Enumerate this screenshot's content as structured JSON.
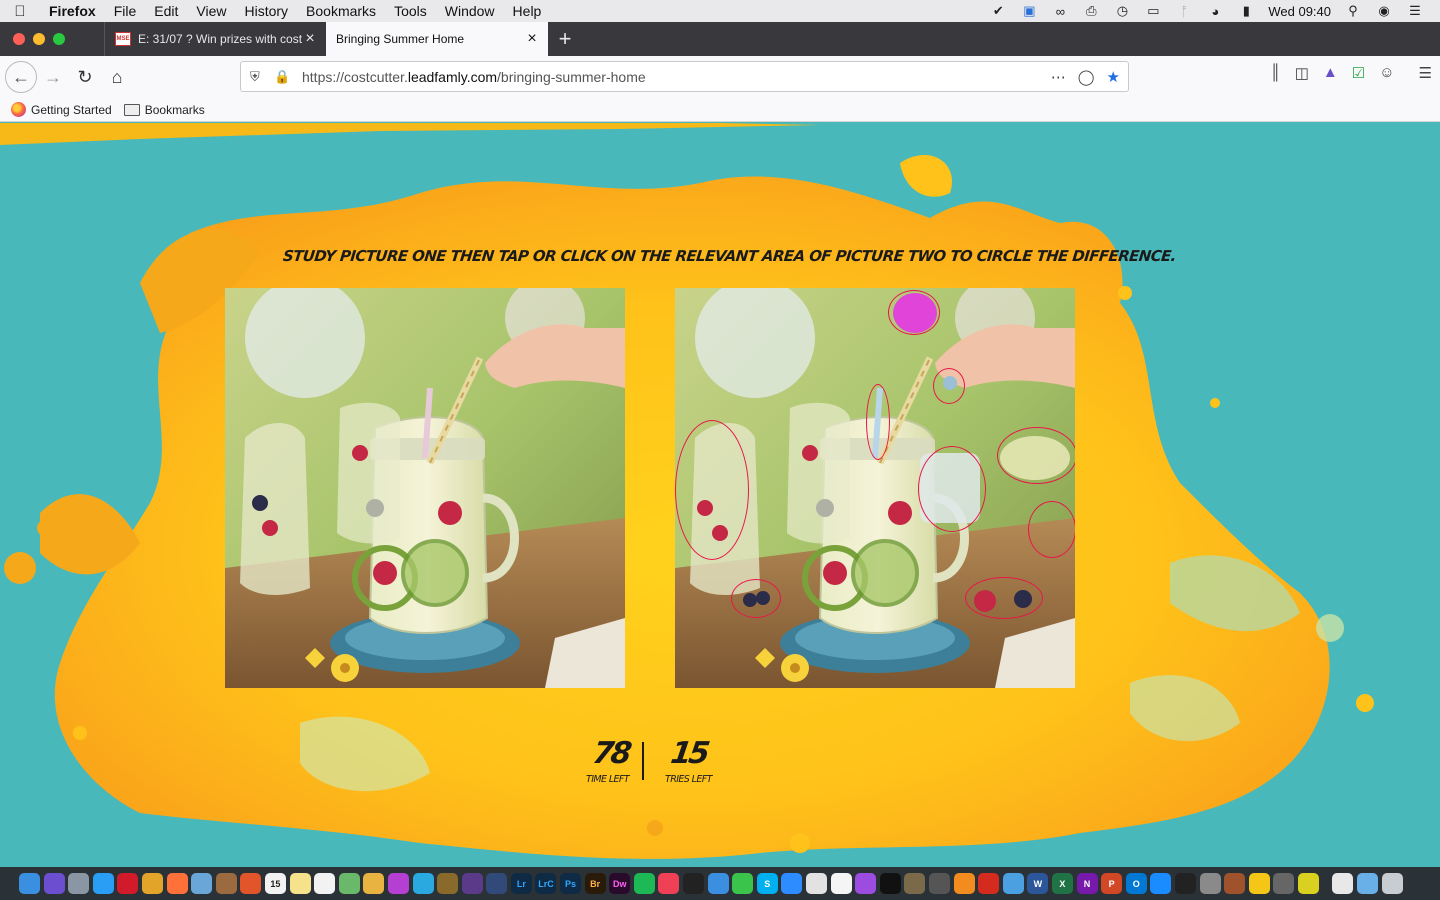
{
  "menubar": {
    "app_name": "Firefox",
    "items": [
      "File",
      "Edit",
      "View",
      "History",
      "Bookmarks",
      "Tools",
      "Window",
      "Help"
    ],
    "clock": "Wed 09:40"
  },
  "tabs": [
    {
      "label": "E: 31/07 ? Win prizes with costc",
      "favicon": "MSE",
      "active": false
    },
    {
      "label": "Bringing Summer Home",
      "favicon": "",
      "active": true
    }
  ],
  "navbar": {
    "url_prefix": "https://costcutter.",
    "url_domain": "leadfamly.com",
    "url_path": "/bringing-summer-home"
  },
  "bookmarks": [
    {
      "label": "Getting Started",
      "icon": "firefox-icon"
    },
    {
      "label": "Bookmarks",
      "icon": "folder-icon"
    }
  ],
  "game": {
    "instruction": "STUDY PICTURE ONE THEN TAP OR CLICK ON THE RELEVANT AREA OF  PICTURE TWO TO CIRCLE THE DIFFERENCE.",
    "time_left": "78",
    "time_left_label": "TIME LEFT",
    "tries_left": "15",
    "tries_left_label": "TRIES LEFT",
    "differences_circled": 10
  },
  "colors": {
    "page_background": "#49b8ba",
    "splash_yellow": "#ffc21a",
    "splash_orange": "#f9a21a",
    "circle_stroke": "#e8174a"
  }
}
